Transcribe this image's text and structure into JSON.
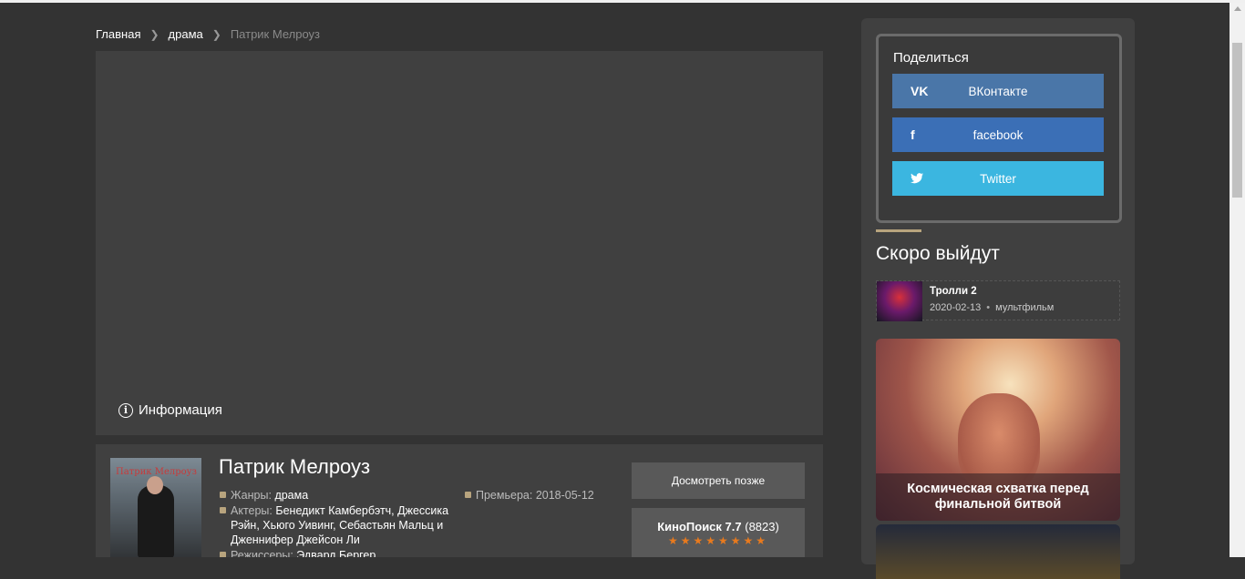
{
  "breadcrumb": {
    "home": "Главная",
    "genre": "драма",
    "current": "Патрик Мелроуз"
  },
  "player": {
    "info_label": "Информация"
  },
  "film": {
    "poster_title": "Патрик Мелроуз",
    "title": "Патрик Мелроуз",
    "genres_label": "Жанры:",
    "genres_value": "драма",
    "actors_label": "Актеры:",
    "actors_value": "Бенедикт Камбербэтч, Джессика Рэйн, Хьюго Уивинг, Себастьян Мальц и Дженнифер Джейсон Ли",
    "directors_label": "Режиссеры:",
    "directors_value": "Эдвард Бергер",
    "premiere_label": "Премьера:",
    "premiere_value": "2018-05-12",
    "watch_later": "Досмотреть позже",
    "kp_label": "КиноПоиск 7.7",
    "kp_votes": "(8823)",
    "kp_stars": "★★★★★★★★",
    "kp_rating": 7.7
  },
  "sidebar": {
    "share_title": "Поделиться",
    "share_buttons": [
      {
        "label": "ВКонтакте",
        "icon": "vk-icon",
        "glyph": "VK",
        "color": "#4a76a8"
      },
      {
        "label": "facebook",
        "icon": "facebook-icon",
        "glyph": "f",
        "color": "#3b6fb6"
      },
      {
        "label": "Twitter",
        "icon": "twitter-icon",
        "glyph": "🐦",
        "color": "#3bb6e0"
      }
    ],
    "soon_title": "Скоро выйдут",
    "soon_items": [
      {
        "name": "Тролли 2",
        "date": "2020-02-13",
        "dot": "•",
        "genre": "мультфильм"
      }
    ],
    "feature_caption": "Космическая схватка перед финальной битвой"
  },
  "colors": {
    "accent": "#b8a47e",
    "background": "#333333",
    "panel": "#404040"
  }
}
